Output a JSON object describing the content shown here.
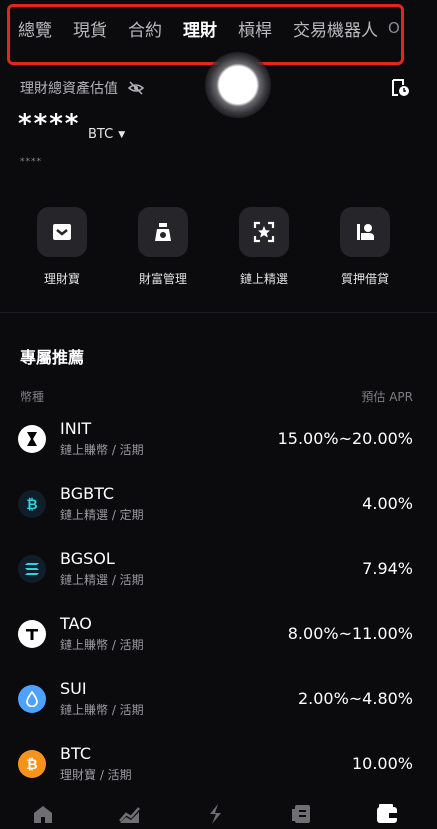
{
  "tabs": [
    {
      "label": "總覽",
      "active": false
    },
    {
      "label": "現貨",
      "active": false
    },
    {
      "label": "合約",
      "active": false
    },
    {
      "label": "理財",
      "active": true
    },
    {
      "label": "槓桿",
      "active": false
    },
    {
      "label": "交易機器人",
      "active": false
    }
  ],
  "tab_overflow": "O",
  "highlight_color": "#e3251f",
  "assets": {
    "label": "理財總資產估值",
    "masked_value": "****",
    "currency": "BTC",
    "masked_sub": "****"
  },
  "shortcuts": [
    {
      "label": "理財寶",
      "icon": "wallet-safe-icon"
    },
    {
      "label": "財富管理",
      "icon": "money-bag-icon"
    },
    {
      "label": "鏈上精選",
      "icon": "star-frame-icon"
    },
    {
      "label": "質押借貸",
      "icon": "hand-coin-icon"
    }
  ],
  "recommend": {
    "title": "專屬推薦",
    "col_coin": "幣種",
    "col_apr": "預估 APR",
    "rows": [
      {
        "name": "INIT",
        "sub": "鏈上賺幣 / 活期",
        "apr": "15.00%~20.00%",
        "icon": "init-coin-icon",
        "icon_bg": "#ffffff",
        "icon_fg": "#000000",
        "glyph": "I"
      },
      {
        "name": "BGBTC",
        "sub": "鏈上精選 / 定期",
        "apr": "4.00%",
        "icon": "bgbtc-coin-icon",
        "icon_bg": "#0f1e2a",
        "icon_fg": "#2fd3e0",
        "glyph": "₿"
      },
      {
        "name": "BGSOL",
        "sub": "鏈上精選 / 活期",
        "apr": "7.94%",
        "icon": "bgsol-coin-icon",
        "icon_bg": "#0f1e2a",
        "icon_fg": "#2fd3e0",
        "glyph": "≡"
      },
      {
        "name": "TAO",
        "sub": "鏈上賺幣 / 活期",
        "apr": "8.00%~11.00%",
        "icon": "tao-coin-icon",
        "icon_bg": "#ffffff",
        "icon_fg": "#000000",
        "glyph": "T"
      },
      {
        "name": "SUI",
        "sub": "鏈上賺幣 / 活期",
        "apr": "2.00%~4.80%",
        "icon": "sui-coin-icon",
        "icon_bg": "#4da2ff",
        "icon_fg": "#ffffff",
        "glyph": "💧"
      },
      {
        "name": "BTC",
        "sub": "理財寶 / 活期",
        "apr": "10.00%",
        "icon": "btc-coin-icon",
        "icon_bg": "#f7931a",
        "icon_fg": "#ffffff",
        "glyph": "₿"
      }
    ]
  },
  "bottom_nav": [
    {
      "icon": "home-icon"
    },
    {
      "icon": "markets-chart-icon"
    },
    {
      "icon": "trade-icon"
    },
    {
      "icon": "futures-icon"
    },
    {
      "icon": "assets-wallet-icon"
    }
  ]
}
